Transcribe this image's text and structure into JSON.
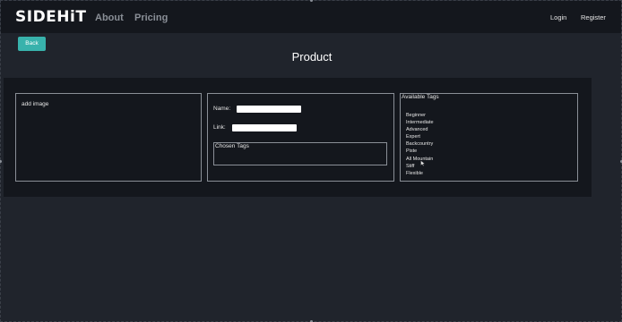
{
  "header": {
    "logo": "SIDEHiT",
    "nav": {
      "about": "About",
      "pricing": "Pricing",
      "login": "Login",
      "register": "Register"
    }
  },
  "main": {
    "back_label": "Back",
    "title": "Product",
    "image_card": {
      "label": "add image"
    },
    "form": {
      "name_label": "Name:",
      "name_value": "",
      "link_label": "Link:",
      "link_value": "",
      "chosen_tags_label": "Chosen Tags"
    },
    "tags": {
      "label": "Available Tags",
      "items": [
        "Beginner",
        "Intermediate",
        "Advanced",
        "Expert",
        "Backcountry",
        "Piste",
        "All Mountain",
        "Stiff",
        "Flexible"
      ]
    }
  },
  "colors": {
    "navbar_bg": "#14171d",
    "page_bg": "#20242c",
    "accent": "#38b2ac",
    "border": "#8a8f97"
  },
  "icons": {
    "cursor": "mouse-pointer-icon"
  }
}
